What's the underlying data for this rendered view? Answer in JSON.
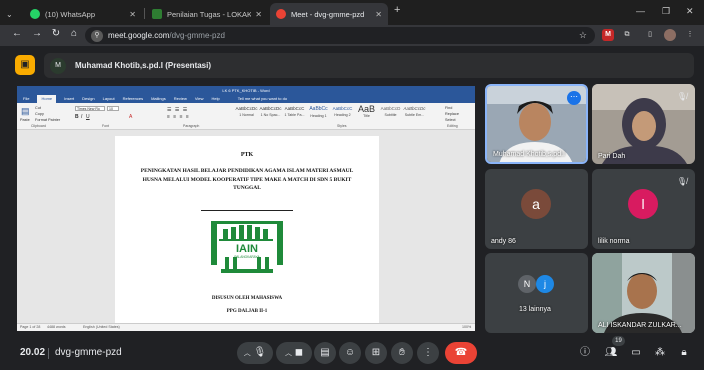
{
  "browser": {
    "tabs": [
      {
        "title": "(10) WhatsApp",
        "icon": "whatsapp-icon",
        "color": "#25d366"
      },
      {
        "title": "Penilaian Tugas - LOKAKARYA",
        "icon": "lokakarya-icon",
        "color": "#2e7d32"
      },
      {
        "title": "Meet - dvg-gmme-pzd",
        "icon": "meet-icon",
        "color": "#ea4335",
        "active": true
      }
    ],
    "url_host": "meet.google.com",
    "url_path": "/dvg-gmme-pzd"
  },
  "presentation": {
    "presenter_initial": "M",
    "presenter_label": "Muhamad Khotib,s.pd.I (Presentasi)"
  },
  "word": {
    "title_bar": "LK 6 PTK_KHOTIB  -  Word",
    "menu": [
      "File",
      "Home",
      "Insert",
      "Design",
      "Layout",
      "References",
      "Mailings",
      "Review",
      "View",
      "Help"
    ],
    "tell_me": "Tell me what you want to do",
    "font_name": "Times New Ro",
    "font_size": "10",
    "clipboard": [
      "Paste",
      "Cut",
      "Copy",
      "Format Painter"
    ],
    "group_labels": [
      "Clipboard",
      "Font",
      "Paragraph",
      "Styles",
      "Editing"
    ],
    "styles": [
      {
        "sample": "AaBbCcDc",
        "label": "1 Normal"
      },
      {
        "sample": "AaBbCcDc",
        "label": "1 No Spac..."
      },
      {
        "sample": "AaBbCcC",
        "label": "1 Table Pa..."
      },
      {
        "sample": "AaBbCc",
        "label": "Heading 1"
      },
      {
        "sample": "AaBbCcC",
        "label": "Heading 2"
      },
      {
        "sample": "AaB",
        "label": "Title"
      },
      {
        "sample": "AaBbCcD",
        "label": "Subtitle"
      },
      {
        "sample": "AaBbCcDc",
        "label": "Subtle Em..."
      }
    ],
    "editing": [
      "Find",
      "Replace",
      "Select"
    ],
    "document": {
      "heading": "PTK",
      "title": "PENINGKATAN HASIL BELAJAR PENDIDIKAN AGAMA ISLAM MATERI ASMAUL HUSNA MELALUI MODEL KOOPERATIF TIPE MAKE A MATCH DI SDN 5 BUKIT TUNGGAL",
      "logo_text": "IAIN",
      "logo_sub": "PALANGKARAYA",
      "by": "DISUSUN OLEH MAHASISWA",
      "program": "PPG DALJAB II-1"
    },
    "status": {
      "page": "Page 1 of 28",
      "words": "4488 words",
      "language": "English (United States)",
      "zoom": "100%"
    }
  },
  "participants": [
    {
      "name": "Muhamad Khotib,s.pd.I",
      "type": "video",
      "speaking": true
    },
    {
      "name": "Pari Dah",
      "type": "video",
      "muted": true
    },
    {
      "name": "andy 86",
      "type": "avatar",
      "initial": "a",
      "color": "#7a4a3a"
    },
    {
      "name": "lilik norma",
      "type": "avatar",
      "initial": "l",
      "color": "#d81b60",
      "muted": true
    },
    {
      "name": "13 lainnya",
      "type": "group",
      "initials": [
        "N",
        "j"
      ],
      "colors": [
        "#5f6368",
        "#1e88e5"
      ]
    },
    {
      "name": "ALI ISKANDAR ZULKAR...",
      "type": "video"
    }
  ],
  "bottom": {
    "time": "20.02",
    "meeting_code": "dvg-gmme-pzd",
    "people_count": "19"
  },
  "colors": {
    "meet_bg": "#202124",
    "tile_bg": "#3c4043",
    "hangup": "#ea4335",
    "word_blue": "#2b579a",
    "logo_green": "#1f8a3a"
  }
}
